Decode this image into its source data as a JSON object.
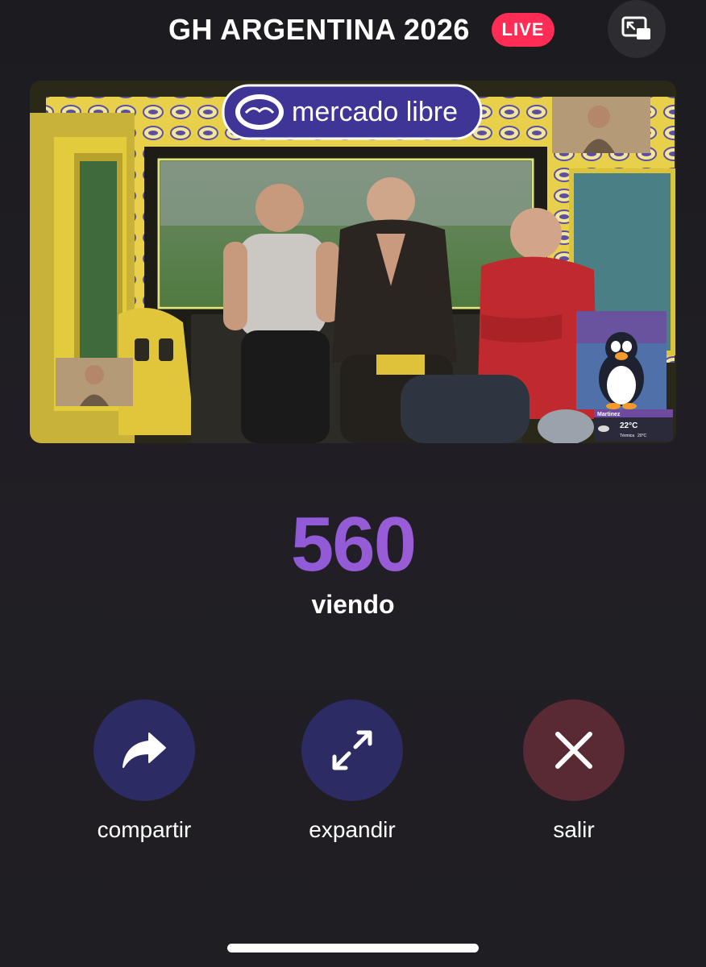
{
  "header": {
    "title": "GH ARGENTINA 2026",
    "live_label": "LIVE",
    "pip_icon": "picture-in-picture-icon"
  },
  "video": {
    "sponsor_logo_text": "mercado libre",
    "weather_widget": {
      "location": "Martinez",
      "temperature": "22°C",
      "feels_like_label": "Térmica",
      "feels_like_value": "20°C"
    }
  },
  "viewers": {
    "count": "560",
    "label": "viendo",
    "count_color_start": "#7a52d9",
    "count_color_end": "#b868c9"
  },
  "actions": [
    {
      "label": "compartir",
      "icon": "share-arrow-icon",
      "color": "#2c2b63"
    },
    {
      "label": "expandir",
      "icon": "expand-arrows-icon",
      "color": "#2c2b63"
    },
    {
      "label": "salir",
      "icon": "close-x-icon",
      "color": "#5a2a34"
    }
  ],
  "colors": {
    "live_badge": "#ff2d55",
    "background": "#1f1e22"
  }
}
